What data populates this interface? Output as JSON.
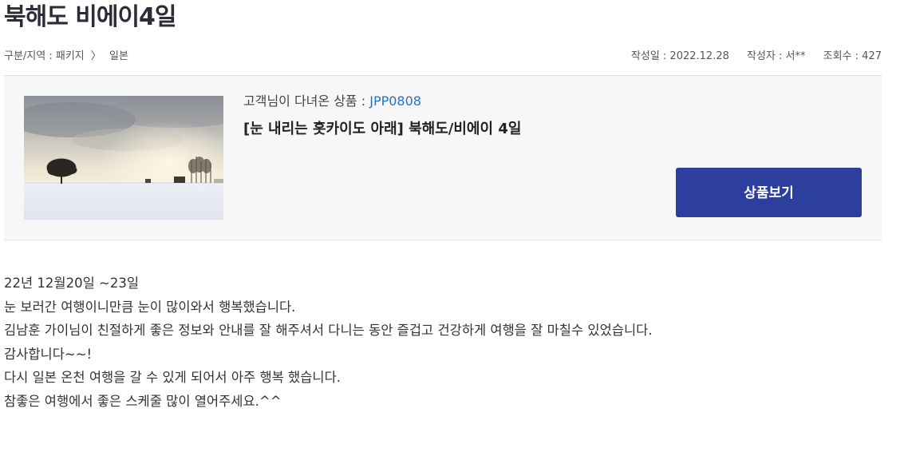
{
  "post": {
    "title": "북해도 비에이4일"
  },
  "meta": {
    "category_label": "구분/지역 : 패키지",
    "chevron": "〉",
    "region": "일본",
    "date": "작성일 : 2022.12.28",
    "author": "작성자 : 서**",
    "views": "조회수 : 427"
  },
  "product": {
    "code_label": "고객님이 다녀온 상품 : ",
    "code": "JPP0808",
    "name": "[눈 내리는 홋카이도 아래] 북해도/비에이 4일",
    "button_label": "상품보기",
    "thumbnail": "snowy-field-with-trees-photo"
  },
  "content": {
    "lines": [
      "22년 12월20일 ~23일",
      "눈 보러간 여행이니만큼 눈이 많이와서  행복했습니다.",
      "김남훈 가이님이 친절하게 좋은 정보와 안내를 잘 해주셔서 다니는 동안 즐겁고 건강하게 여행을 잘 마칠수 있었습니다.",
      "감사합니다~~!",
      "다시 일본 온천 여행을 갈 수 있게 되어서 아주 행복 했습니다.",
      "참좋은 여행에서 좋은 스케줄 많이 열어주세요.^^"
    ]
  },
  "colors": {
    "button_bg": "#2c3e9e",
    "product_code": "#1f73c8",
    "box_bg": "#f7f7f8"
  }
}
